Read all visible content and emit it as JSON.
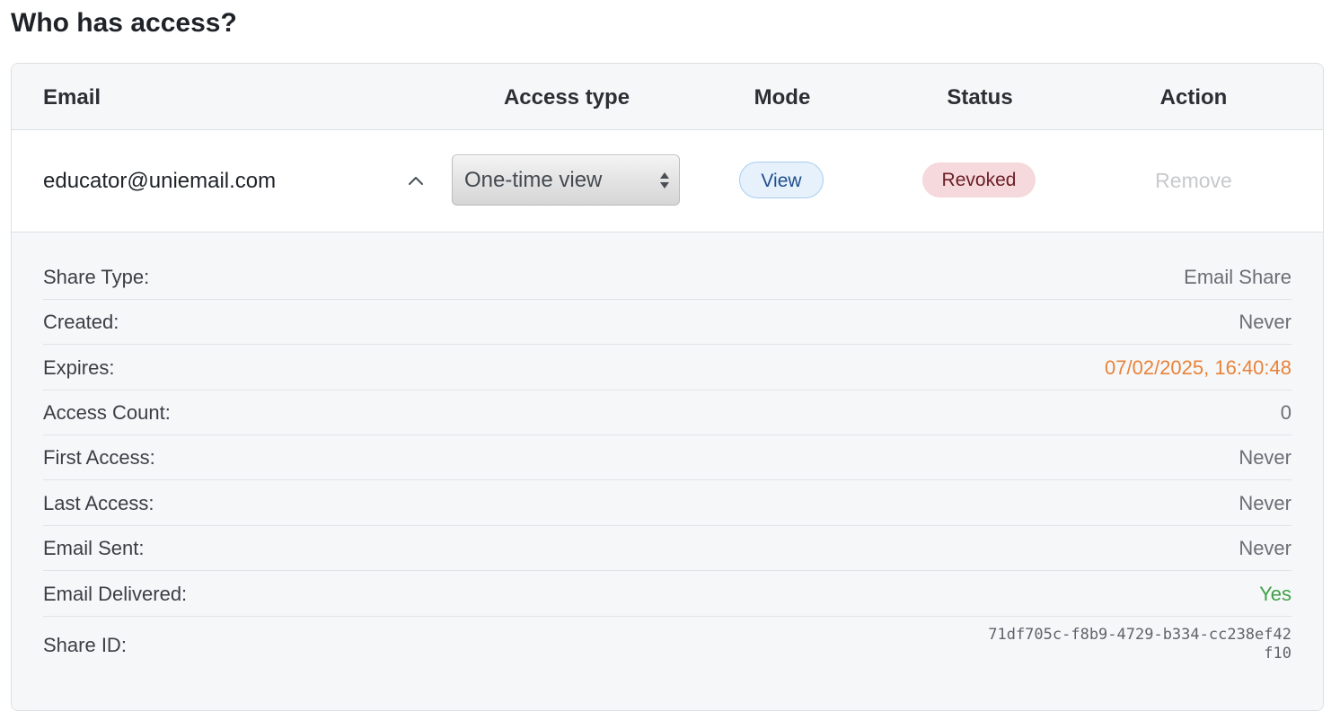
{
  "page": {
    "title": "Who has access?"
  },
  "table": {
    "headers": {
      "email": "Email",
      "access_type": "Access type",
      "mode": "Mode",
      "status": "Status",
      "action": "Action"
    },
    "row": {
      "email": "educator@uniemail.com",
      "expanded": true,
      "access_type_selected": "One-time view",
      "mode": "View",
      "status": "Revoked",
      "action": "Remove",
      "action_disabled": true
    }
  },
  "details": {
    "items": [
      {
        "label": "Share Type:",
        "value": "Email Share"
      },
      {
        "label": "Created:",
        "value": "Never"
      },
      {
        "label": "Expires:",
        "value": "07/02/2025, 16:40:48"
      },
      {
        "label": "Access Count:",
        "value": "0"
      },
      {
        "label": "First Access:",
        "value": "Never"
      },
      {
        "label": "Last Access:",
        "value": "Never"
      },
      {
        "label": "Email Sent:",
        "value": "Never"
      },
      {
        "label": "Email Delivered:",
        "value": "Yes"
      },
      {
        "label": "Share ID:",
        "value": "71df705c-f8b9-4729-b334-cc238ef42f10"
      }
    ]
  },
  "colors": {
    "expires_value": "#e8833a",
    "delivered_value": "#3fa146",
    "status_badge_bg": "#f5d9dc",
    "mode_badge_bg": "#e6f1fc"
  },
  "icons": {
    "expand_toggle": "chevron-up-icon",
    "select_arrows": "select-arrows-icon"
  }
}
